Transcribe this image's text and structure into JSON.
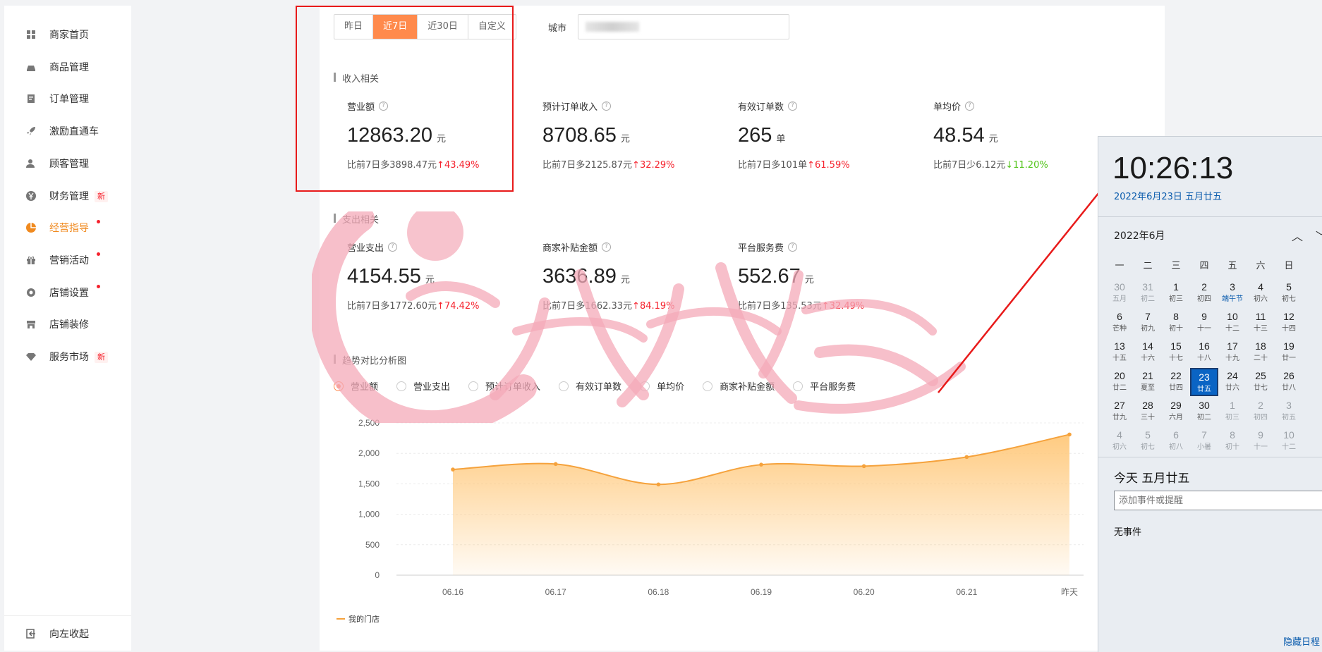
{
  "sidebar": {
    "items": [
      {
        "label": "商家首页",
        "icon": "dashboard-icon",
        "badge": ""
      },
      {
        "label": "商品管理",
        "icon": "product-icon",
        "badge": ""
      },
      {
        "label": "订单管理",
        "icon": "order-icon",
        "badge": ""
      },
      {
        "label": "激励直通车",
        "icon": "rocket-icon",
        "badge": ""
      },
      {
        "label": "顾客管理",
        "icon": "customer-icon",
        "badge": ""
      },
      {
        "label": "财务管理",
        "icon": "yuan-icon",
        "badge": "新"
      },
      {
        "label": "经营指导",
        "icon": "pie-chart-icon",
        "badge": "",
        "active": true,
        "dot": true
      },
      {
        "label": "营销活动",
        "icon": "gift-icon",
        "badge": "",
        "dot": true
      },
      {
        "label": "店铺设置",
        "icon": "settings-icon",
        "badge": "",
        "dot": true
      },
      {
        "label": "店铺装修",
        "icon": "store-icon",
        "badge": ""
      },
      {
        "label": "服务市场",
        "icon": "diamond-icon",
        "badge": "新"
      }
    ],
    "collapse_label": "向左收起"
  },
  "filters": {
    "tabs": [
      "昨日",
      "近7日",
      "近30日",
      "自定义"
    ],
    "active_tab": "近7日",
    "city_label": "城市"
  },
  "income": {
    "title": "收入相关",
    "metrics": [
      {
        "label": "营业额",
        "value": "12863.20",
        "unit": "元",
        "cmp": "比前7日多3898.47元",
        "trend": "up",
        "pct": "43.49%"
      },
      {
        "label": "预计订单收入",
        "value": "8708.65",
        "unit": "元",
        "cmp": "比前7日多2125.87元",
        "trend": "up",
        "pct": "32.29%"
      },
      {
        "label": "有效订单数",
        "value": "265",
        "unit": "单",
        "cmp": "比前7日多101单",
        "trend": "up",
        "pct": "61.59%"
      },
      {
        "label": "单均价",
        "value": "48.54",
        "unit": "元",
        "cmp": "比前7日少6.12元",
        "trend": "down",
        "pct": "11.20%"
      }
    ]
  },
  "expense": {
    "title": "支出相关",
    "metrics": [
      {
        "label": "营业支出",
        "value": "4154.55",
        "unit": "元",
        "cmp": "比前7日多1772.60元",
        "trend": "up",
        "pct": "74.42%"
      },
      {
        "label": "商家补贴金额",
        "value": "3636.89",
        "unit": "元",
        "cmp": "比前7日多1662.33元",
        "trend": "up",
        "pct": "84.19%"
      },
      {
        "label": "平台服务费",
        "value": "552.67",
        "unit": "元",
        "cmp": "比前7日多135.53元",
        "trend": "up",
        "pct": "32.49%"
      }
    ]
  },
  "trend": {
    "title": "趋势对比分析图",
    "options": [
      "营业额",
      "营业支出",
      "预计订单收入",
      "有效订单数",
      "单均价",
      "商家补贴金额",
      "平台服务费"
    ],
    "selected": "营业额",
    "legend": "我的门店"
  },
  "chart_data": {
    "type": "area",
    "categories": [
      "06.16",
      "06.17",
      "06.18",
      "06.19",
      "06.20",
      "06.21",
      "昨天"
    ],
    "series": [
      {
        "name": "我的门店",
        "values": [
          1735,
          1825,
          1490,
          1815,
          1790,
          1940,
          2310
        ]
      }
    ],
    "ylim": [
      0,
      2500
    ],
    "yticks": [
      "0",
      "500",
      "1,000",
      "1,500",
      "2,000",
      "2,500"
    ],
    "grid": true,
    "legend_position": "bottom-left",
    "colors": {
      "line": "#f5a23c",
      "fill": "#ffc87a"
    }
  },
  "watermark": {
    "text": "爱爱谷",
    "color": "#f4a9b8"
  },
  "annotation": {
    "color": "#e81a1a"
  },
  "calendar": {
    "time": "10:26:13",
    "date": "2022年6月23日 五月廿五",
    "month": "2022年6月",
    "weekdays": [
      "一",
      "二",
      "三",
      "四",
      "五",
      "六",
      "日"
    ],
    "days": [
      {
        "d": "30",
        "l": "五月",
        "dim": true
      },
      {
        "d": "31",
        "l": "初二",
        "dim": true
      },
      {
        "d": "1",
        "l": "初三"
      },
      {
        "d": "2",
        "l": "初四"
      },
      {
        "d": "3",
        "l": "端午节",
        "fest": true
      },
      {
        "d": "4",
        "l": "初六"
      },
      {
        "d": "5",
        "l": "初七"
      },
      {
        "d": "6",
        "l": "芒种"
      },
      {
        "d": "7",
        "l": "初九"
      },
      {
        "d": "8",
        "l": "初十"
      },
      {
        "d": "9",
        "l": "十一"
      },
      {
        "d": "10",
        "l": "十二"
      },
      {
        "d": "11",
        "l": "十三"
      },
      {
        "d": "12",
        "l": "十四"
      },
      {
        "d": "13",
        "l": "十五"
      },
      {
        "d": "14",
        "l": "十六"
      },
      {
        "d": "15",
        "l": "十七"
      },
      {
        "d": "16",
        "l": "十八"
      },
      {
        "d": "17",
        "l": "十九"
      },
      {
        "d": "18",
        "l": "二十"
      },
      {
        "d": "19",
        "l": "廿一"
      },
      {
        "d": "20",
        "l": "廿二"
      },
      {
        "d": "21",
        "l": "夏至"
      },
      {
        "d": "22",
        "l": "廿四"
      },
      {
        "d": "23",
        "l": "廿五",
        "today": true
      },
      {
        "d": "24",
        "l": "廿六"
      },
      {
        "d": "25",
        "l": "廿七"
      },
      {
        "d": "26",
        "l": "廿八"
      },
      {
        "d": "27",
        "l": "廿九"
      },
      {
        "d": "28",
        "l": "三十"
      },
      {
        "d": "29",
        "l": "六月"
      },
      {
        "d": "30",
        "l": "初二"
      },
      {
        "d": "1",
        "l": "初三",
        "dim": true
      },
      {
        "d": "2",
        "l": "初四",
        "dim": true
      },
      {
        "d": "3",
        "l": "初五",
        "dim": true
      },
      {
        "d": "4",
        "l": "初六",
        "dim": true
      },
      {
        "d": "5",
        "l": "初七",
        "dim": true
      },
      {
        "d": "6",
        "l": "初八",
        "dim": true
      },
      {
        "d": "7",
        "l": "小暑",
        "dim": true
      },
      {
        "d": "8",
        "l": "初十",
        "dim": true
      },
      {
        "d": "9",
        "l": "十一",
        "dim": true
      },
      {
        "d": "10",
        "l": "十二",
        "dim": true
      }
    ],
    "today_label": "今天 五月廿五",
    "event_placeholder": "添加事件或提醒",
    "no_events": "无事件",
    "hide_label": "隐藏日程"
  }
}
